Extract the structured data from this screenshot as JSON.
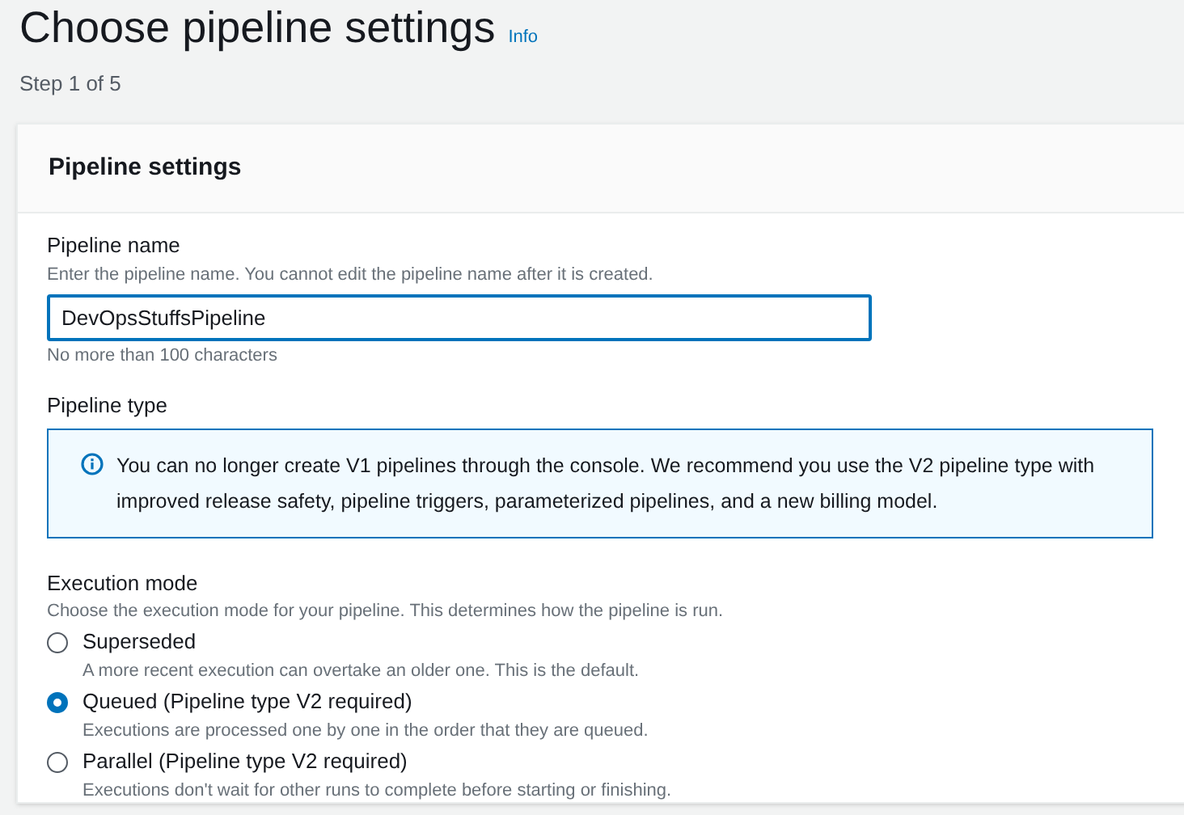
{
  "page": {
    "title": "Choose pipeline settings",
    "info_link": "Info",
    "step": "Step 1 of 5"
  },
  "card": {
    "title": "Pipeline settings",
    "pipeline_name": {
      "label": "Pipeline name",
      "description": "Enter the pipeline name. You cannot edit the pipeline name after it is created.",
      "value": "DevOpsStuffsPipeline",
      "constraint": "No more than 100 characters"
    },
    "pipeline_type": {
      "label": "Pipeline type",
      "alert": "You can no longer create V1 pipelines through the console. We recommend you use the V2 pipeline type with improved release safety, pipeline triggers, parameterized pipelines, and a new billing model."
    },
    "execution_mode": {
      "label": "Execution mode",
      "description": "Choose the execution mode for your pipeline. This determines how the pipeline is run.",
      "options": [
        {
          "label": "Superseded",
          "description": "A more recent execution can overtake an older one. This is the default.",
          "selected": false
        },
        {
          "label": "Queued (Pipeline type V2 required)",
          "description": "Executions are processed one by one in the order that they are queued.",
          "selected": true
        },
        {
          "label": "Parallel (Pipeline type V2 required)",
          "description": "Executions don't wait for other runs to complete before starting or finishing.",
          "selected": false
        }
      ]
    }
  }
}
